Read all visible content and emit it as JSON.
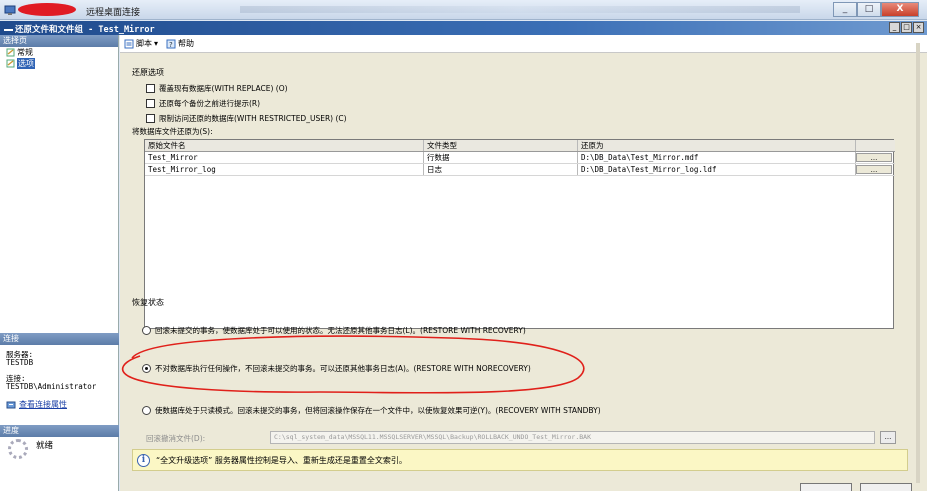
{
  "rdp": {
    "title": "远程桌面连接",
    "btn_min": "_",
    "btn_max": "□",
    "btn_close": "X"
  },
  "dialog": {
    "title": "还原文件和文件组 - Test_Mirror",
    "btn_min": "_",
    "btn_max": "□",
    "btn_close": "×"
  },
  "sidebar": {
    "header": "选择页",
    "items": [
      {
        "label": "常规",
        "selected": false
      },
      {
        "label": "选项",
        "selected": true
      }
    ],
    "connection_header": "连接",
    "server_label": "服务器:",
    "server_value": "TESTDB",
    "conn_label": "连接:",
    "conn_value": "TESTDB\\Administrator",
    "view_link": "查看连接属性",
    "progress_header": "进度",
    "progress_status": "就绪"
  },
  "toolbar": {
    "script_label": "脚本",
    "dropdown_arrow": "▾",
    "help_label": "帮助"
  },
  "options": {
    "title": "还原选项",
    "overwrite": "覆盖现有数据库(WITH REPLACE) (O)",
    "prompt": "还原每个备份之前进行提示(R)",
    "restrict": "限制访问还原的数据库(WITH RESTRICTED_USER) (C)",
    "restore_as": "将数据库文件还原为(S):"
  },
  "grid": {
    "headers": [
      "原始文件名",
      "文件类型",
      "还原为"
    ],
    "rows": [
      {
        "name": "Test_Mirror",
        "type": "行数据",
        "path": "D:\\DB_Data\\Test_Mirror.mdf",
        "btn": "..."
      },
      {
        "name": "Test_Mirror_log",
        "type": "日志",
        "path": "D:\\DB_Data\\Test_Mirror_log.ldf",
        "btn": "..."
      }
    ]
  },
  "recovery": {
    "title": "恢复状态",
    "opt1": "回滚未提交的事务，使数据库处于可以使用的状态。无法还原其他事务日志(L)。(RESTORE WITH RECOVERY)",
    "opt2": "不对数据库执行任何操作，不回滚未提交的事务。可以还原其他事务日志(A)。(RESTORE WITH NORECOVERY)",
    "opt3": "使数据库处于只读模式。回滚未提交的事务，但将回滚操作保存在一个文件中，以使恢复效果可逆(Y)。(RECOVERY WITH STANDBY)",
    "selected": 2,
    "undo_label": "回滚撤消文件(D):",
    "undo_value": "C:\\sql_system_data\\MSSQL11.MSSQLSERVER\\MSSQL\\Backup\\ROLLBACK_UNDO_Test_Mirror.BAK",
    "undo_btn": "..."
  },
  "info": {
    "icon": "i",
    "text": "“全文升级选项” 服务器属性控制是导入、重新生成还是重置全文索引。"
  },
  "colors": {
    "annotation": "#e0201a",
    "title_bar": "#1f4a8c",
    "selection": "#2f63b5"
  }
}
